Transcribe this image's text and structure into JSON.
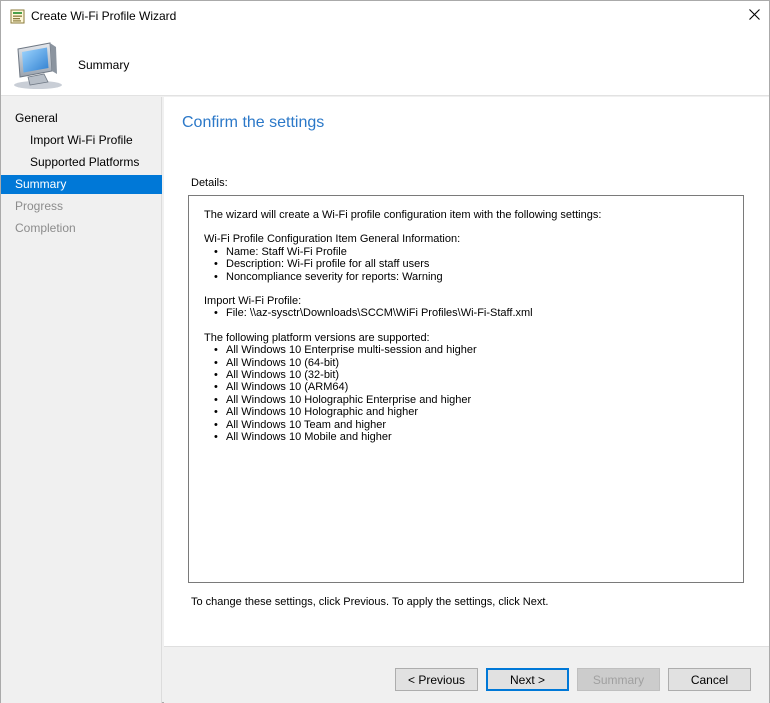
{
  "window": {
    "title": "Create Wi-Fi Profile Wizard",
    "icon": "wizard-app-icon",
    "close_icon": "close-icon"
  },
  "header": {
    "title": "Summary",
    "icon": "computer-monitor-icon"
  },
  "nav": {
    "items": [
      {
        "label": "General",
        "state": "normal"
      },
      {
        "label": "Import Wi-Fi Profile",
        "state": "normal"
      },
      {
        "label": "Supported Platforms",
        "state": "normal"
      },
      {
        "label": "Summary",
        "state": "active"
      },
      {
        "label": "Progress",
        "state": "disabled"
      },
      {
        "label": "Completion",
        "state": "disabled"
      }
    ]
  },
  "main": {
    "heading": "Confirm the settings",
    "details_label": "Details:",
    "details": {
      "intro": "The wizard will create a Wi-Fi profile configuration item with the following settings:",
      "general_heading": "Wi-Fi Profile Configuration Item General Information:",
      "general_items": [
        "Name: Staff Wi-Fi Profile",
        "Description: Wi-Fi profile for all staff users",
        "Noncompliance severity for reports: Warning"
      ],
      "import_heading": "Import Wi-Fi Profile:",
      "import_items": [
        "File: \\\\az-sysctr\\Downloads\\SCCM\\WiFi Profiles\\Wi-Fi-Staff.xml"
      ],
      "platforms_heading": "The following platform versions are supported:",
      "platform_items": [
        "All Windows 10 Enterprise multi-session and higher",
        "All Windows 10 (64-bit)",
        "All Windows 10 (32-bit)",
        "All Windows 10 (ARM64)",
        "All Windows 10 Holographic Enterprise and higher",
        "All Windows 10 Holographic and higher",
        "All Windows 10 Team and higher",
        "All Windows 10 Mobile and higher"
      ]
    },
    "footer_note": "To change these settings, click Previous. To apply the settings, click Next."
  },
  "buttons": {
    "previous": "< Previous",
    "next": "Next >",
    "summary": "Summary",
    "cancel": "Cancel"
  },
  "colors": {
    "accent": "#0078d7",
    "heading": "#2b78c8",
    "disabled_text": "#8c8c8c"
  }
}
